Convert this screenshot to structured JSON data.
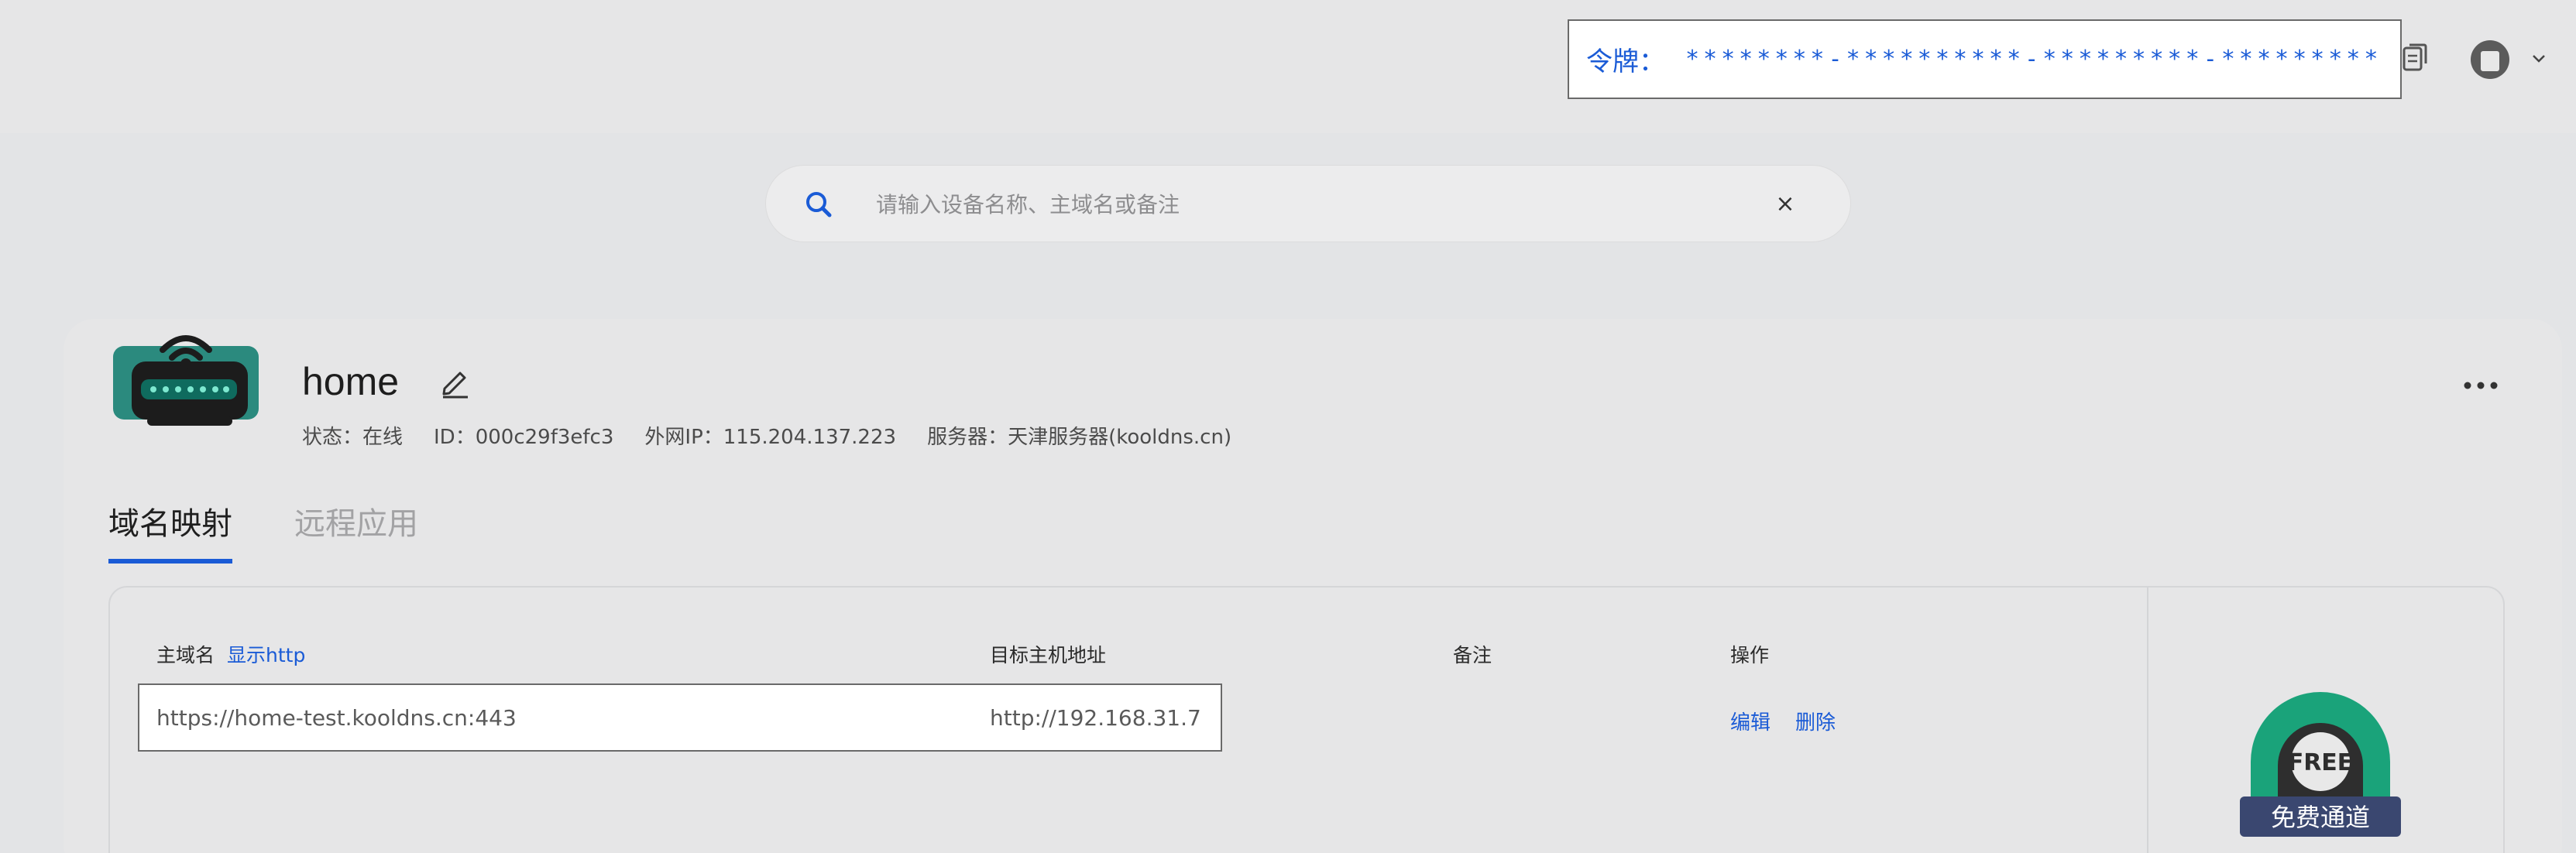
{
  "header": {
    "token_label": "令牌：",
    "token_value": "********-**********-*********-*********"
  },
  "search": {
    "placeholder": "请输入设备名称、主域名或备注",
    "clear_symbol": "×"
  },
  "device": {
    "name": "home",
    "status": "状态：在线",
    "id": "ID：000c29f3efc3",
    "external_ip": "外网IP：115.204.137.223",
    "server": "服务器：天津服务器(kooldns.cn)"
  },
  "tabs": [
    {
      "label": "域名映射",
      "active": true
    },
    {
      "label": "远程应用",
      "active": false
    }
  ],
  "table": {
    "headers": {
      "domain": "主域名",
      "show_http": "显示http",
      "target": "目标主机地址",
      "note": "备注",
      "actions": "操作"
    },
    "rows": [
      {
        "domain": "https://home-test.kooldns.cn:443",
        "target": "http://192.168.31.7",
        "note": "",
        "edit": "编辑",
        "delete": "删除"
      }
    ]
  },
  "badge": {
    "top_text": "FREE",
    "bottom_text": "免费通道"
  },
  "colors": {
    "accent": "#1a5bd6",
    "badge_green": "#1aa37a"
  }
}
